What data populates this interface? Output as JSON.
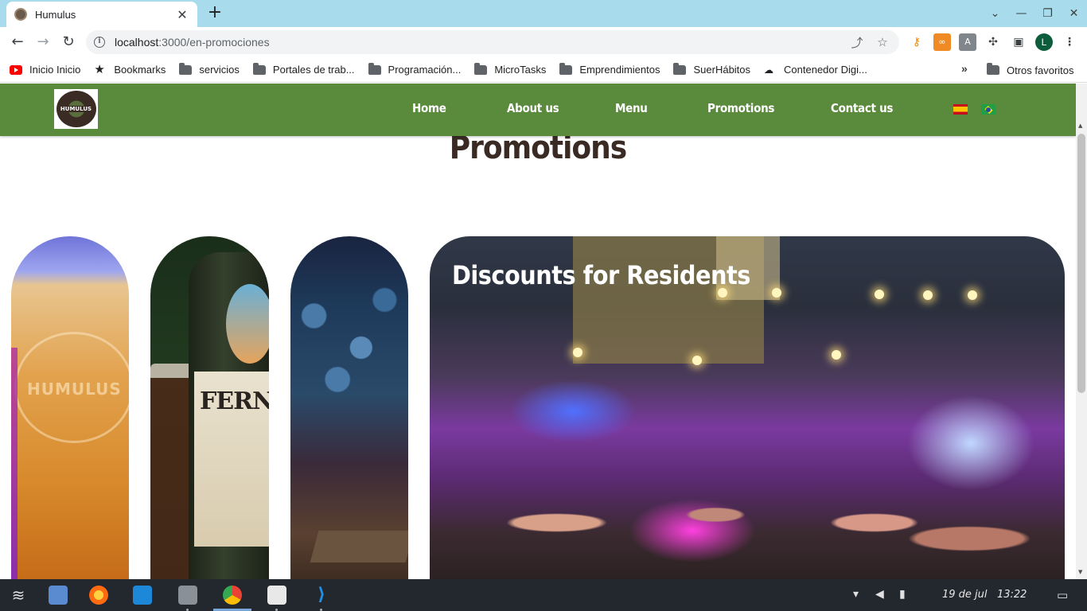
{
  "browser": {
    "tab_title": "Humulus",
    "tab_close": "✕",
    "new_tab": "+",
    "url_host": "localhost",
    "url_path": ":3000/en-promociones",
    "profile_initial": "L",
    "window_controls": [
      "⌄",
      "—",
      "❐",
      "✕"
    ]
  },
  "bookmarks": {
    "items": [
      {
        "label": "Inicio Inicio",
        "icon": "youtube-icon"
      },
      {
        "label": "Bookmarks",
        "icon": "star-icon"
      },
      {
        "label": "servicios",
        "icon": "folder-icon"
      },
      {
        "label": "Portales de trab...",
        "icon": "folder-icon"
      },
      {
        "label": "Programación...",
        "icon": "folder-icon"
      },
      {
        "label": "MicroTasks",
        "icon": "folder-icon"
      },
      {
        "label": "Emprendimientos",
        "icon": "folder-icon"
      },
      {
        "label": "SuerHábitos",
        "icon": "folder-icon"
      },
      {
        "label": "Contenedor Digi...",
        "icon": "cloud-icon"
      }
    ],
    "more": "»",
    "other": "Otros favoritos"
  },
  "site": {
    "logo_text": "HUMULUS",
    "nav": [
      "Home",
      "About us",
      "Menu",
      "Promotions",
      "Contact us"
    ],
    "page_title": "Promotions",
    "card_title": "Discounts for Residents",
    "glass_text": "HUMULUS",
    "bottle_text": "FERNET"
  },
  "taskbar": {
    "date": "19 de jul",
    "time": "13:22"
  },
  "colors": {
    "nav_bg": "#5a8a3c",
    "title": "#3a2a24",
    "tab_bar": "#a8dcec"
  }
}
